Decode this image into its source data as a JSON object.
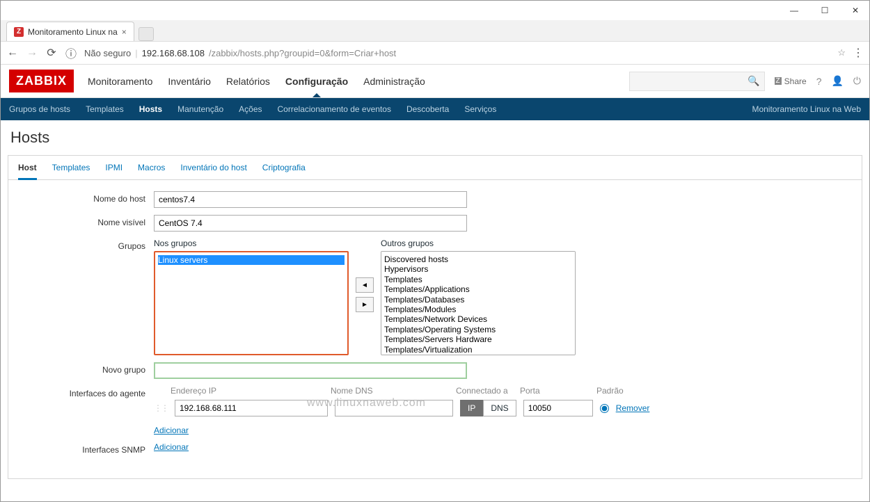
{
  "window": {
    "minimize": "—",
    "maximize": "☐",
    "close": "✕"
  },
  "browser": {
    "tab_title": "Monitoramento Linux na",
    "url_notsecure": "Não seguro",
    "url_host": "192.168.68.108",
    "url_path": "/zabbix/hosts.php?groupid=0&form=Criar+host"
  },
  "brand": "ZABBIX",
  "topnav": [
    "Monitoramento",
    "Inventário",
    "Relatórios",
    "Configuração",
    "Administração"
  ],
  "topnav_active": 3,
  "share": "Share",
  "subnav": [
    "Grupos de hosts",
    "Templates",
    "Hosts",
    "Manutenção",
    "Ações",
    "Correlacionamento de eventos",
    "Descoberta",
    "Serviços"
  ],
  "subnav_active": 2,
  "subnav_right": "Monitoramento Linux na Web",
  "page_title": "Hosts",
  "content_tabs": [
    "Host",
    "Templates",
    "IPMI",
    "Macros",
    "Inventário do host",
    "Criptografia"
  ],
  "content_tabs_active": 0,
  "form": {
    "hostname_label": "Nome do host",
    "hostname": "centos7.4",
    "visible_label": "Nome visível",
    "visible": "CentOS 7.4",
    "groups_label": "Grupos",
    "ingroups_label": "Nos grupos",
    "ingroups": [
      "Linux servers"
    ],
    "othergroups_label": "Outros grupos",
    "othergroups": [
      "Discovered hosts",
      "Hypervisors",
      "Templates",
      "Templates/Applications",
      "Templates/Databases",
      "Templates/Modules",
      "Templates/Network Devices",
      "Templates/Operating Systems",
      "Templates/Servers Hardware",
      "Templates/Virtualization"
    ],
    "newgroup_label": "Novo grupo",
    "newgroup": "",
    "agent_label": "Interfaces do agente",
    "agent_headers": {
      "ip": "Endereço IP",
      "dns": "Nome DNS",
      "conn": "Connectado a",
      "port": "Porta",
      "default": "Padrão"
    },
    "agent": {
      "ip": "192.168.68.111",
      "dns": "",
      "conn_ip": "IP",
      "conn_dns": "DNS",
      "port": "10050",
      "remove": "Remover"
    },
    "add": "Adicionar",
    "snmp_label": "Interfaces SNMP"
  },
  "watermark": "www.linuxnaweb.com"
}
